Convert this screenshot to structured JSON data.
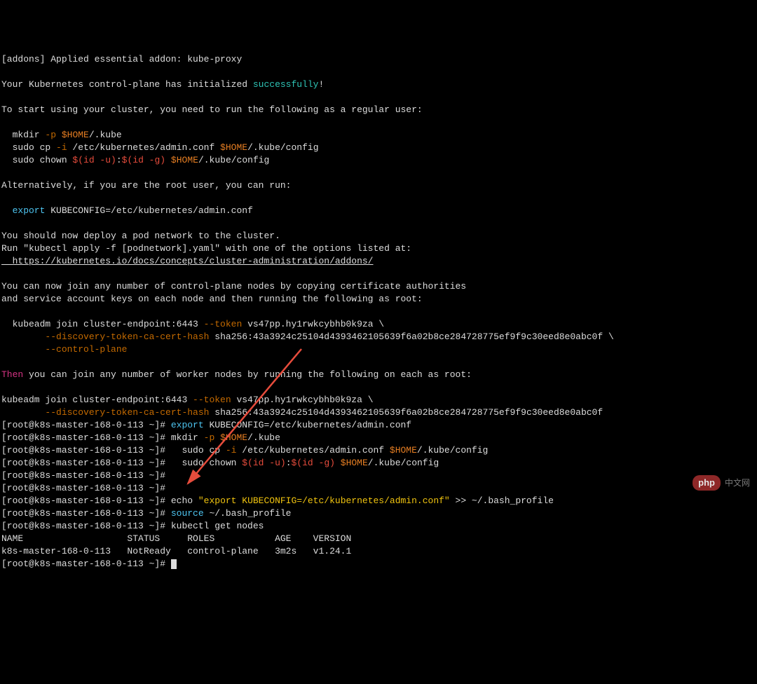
{
  "addons_line": "[addons] Applied essential addon: kube-proxy",
  "cp_line_pre": "Your Kubernetes control-plane has initialized ",
  "cp_success": "successfully",
  "cp_line_post": "!",
  "start_msg": "To start using your cluster, you need to run the following as a regular user:",
  "mkdir_cmd": "  mkdir ",
  "mkdir_flag": "-p",
  "mkdir_sp": " ",
  "home_var": "$HOME",
  "mkdir_tail": "/.kube",
  "cp_cmd": "  sudo cp ",
  "cp_flag": "-i",
  "cp_mid": " /etc/kubernetes/admin.conf ",
  "cp_tail": "/.kube/config",
  "chown_cmd": "  sudo chown ",
  "chown_sub1": "$(",
  "chown_idu": "id -u",
  "chown_sub2": ")",
  "chown_colon": ":",
  "chown_idg": "id -g",
  "chown_sp": " ",
  "chown_tail": "/.kube/config",
  "alt_msg": "Alternatively, if you are the root user, you can run:",
  "export_cmd": "  export",
  "export_rest": " KUBECONFIG=/etc/kubernetes/admin.conf",
  "deploy_msg": "You should now deploy a pod network to the cluster.",
  "apply_msg": "Run \"kubectl apply -f [podnetwork].yaml\" with one of the options listed at:",
  "addons_url": "  https://kubernetes.io/docs/concepts/cluster-administration/addons/",
  "join_msg1": "You can now join any number of control-plane nodes by copying certificate authorities",
  "join_msg2": "and service account keys on each node and then running the following as root:",
  "kubeadm_pre": "  kubeadm join cluster-endpoint:6443 ",
  "token_flag": "--token",
  "token_val": " vs47pp.hy1rwkcybhb0k9za \\",
  "dtch_pre": "        ",
  "dtch_flag": "--discovery-token-ca-cert-hash",
  "dtch_val": " sha256:43a3924c25104d4393462105639f6a02b8ce284728775ef9f9c30eed8e0abc0f \\",
  "ctrl_pre": "        ",
  "ctrl_flag": "--control-plane",
  "then_word": "Then",
  "then_rest": " you can join any number of worker nodes by running the following on each as root:",
  "kubeadm2_pre": "kubeadm join cluster-endpoint:6443 ",
  "kubeadm2_val": " vs47pp.hy1rwkcybhb0k9za \\",
  "dtch2_pre": "        ",
  "dtch2_val": " sha256:43a3924c25104d4393462105639f6a02b8ce284728775ef9f9c30eed8e0abc0f",
  "prompt_pre": "[root@k8s-master-168-0-113 ~]# ",
  "cmd_export": "export",
  "cmd_export_rest": " KUBECONFIG=/etc/kubernetes/admin.conf",
  "cmd_mkdir": "mkdir ",
  "cmd_mkdir_flag": "-p",
  "cmd_mkdir_sp": " ",
  "cmd_mkdir_tail": "/.kube",
  "cmd_cp_pre": "  sudo cp ",
  "cmd_cp_flag": "-i",
  "cmd_cp_mid": " /etc/kubernetes/admin.conf ",
  "cmd_cp_tail": "/.kube/config",
  "cmd_chown_pre": "  sudo chown ",
  "cmd_chown_idu": "id -u",
  "cmd_chown_idg": "id -g",
  "cmd_chown_tail": "/.kube/config",
  "cmd_echo_pre": "echo ",
  "cmd_echo_str": "\"export KUBECONFIG=/etc/kubernetes/admin.conf\"",
  "cmd_echo_post": " >> ~/.bash_profile",
  "cmd_source": "source",
  "cmd_source_rest": " ~/.bash_profile",
  "cmd_kubectl": "kubectl get nodes",
  "hdr": "NAME                   STATUS     ROLES           AGE    VERSION",
  "row": "k8s-master-168-0-113   NotReady   control-plane   3m2s   v1.24.1",
  "watermark_badge": "php",
  "watermark_text": "中文网"
}
